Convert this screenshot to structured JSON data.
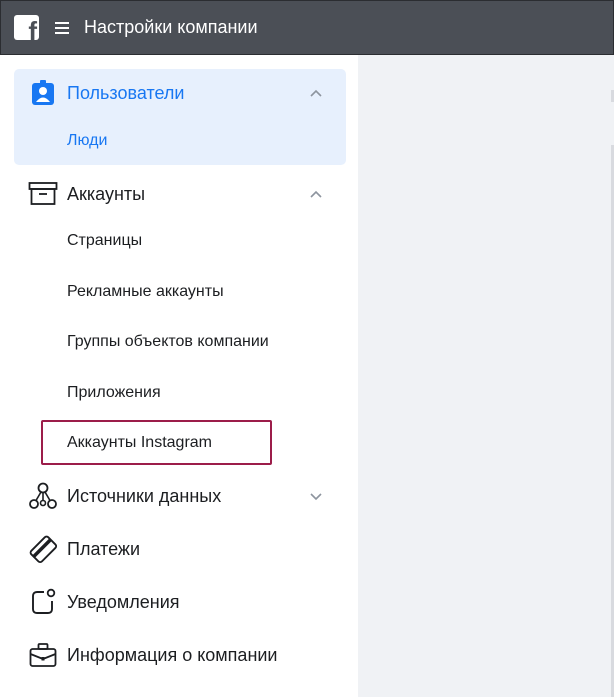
{
  "topbar": {
    "logo_letter": "f",
    "title": "Настройки компании"
  },
  "sidebar": {
    "sections": [
      {
        "label": "Пользователи",
        "icon": "user-badge-icon",
        "expanded": true,
        "active": true,
        "items": [
          {
            "label": "Люди",
            "active": true
          }
        ]
      },
      {
        "label": "Аккаунты",
        "icon": "archive-box-icon",
        "expanded": true,
        "items": [
          {
            "label": "Страницы"
          },
          {
            "label": "Рекламные аккаунты"
          },
          {
            "label": "Группы объектов компании"
          },
          {
            "label": "Приложения"
          },
          {
            "label": "Аккаунты Instagram",
            "highlighted": true
          }
        ]
      },
      {
        "label": "Источники данных",
        "icon": "data-sources-icon",
        "expanded": false
      },
      {
        "label": "Платежи",
        "icon": "credit-card-icon"
      },
      {
        "label": "Уведомления",
        "icon": "notification-icon"
      },
      {
        "label": "Информация о компании",
        "icon": "briefcase-icon"
      }
    ]
  },
  "colors": {
    "topbar_bg": "#4b4f56",
    "active_bg": "#e7f0fd",
    "accent": "#1877f2",
    "highlight_border": "#9c1d4a"
  }
}
